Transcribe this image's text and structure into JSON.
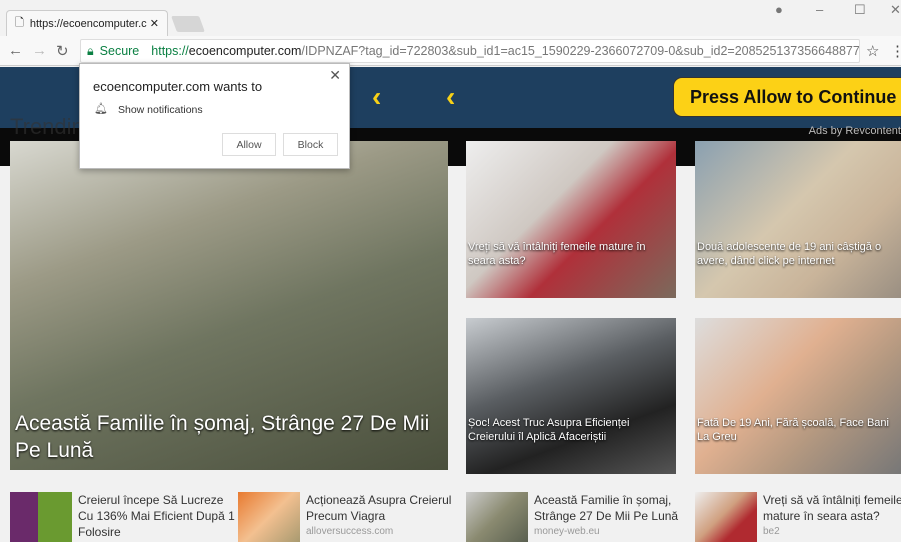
{
  "browser": {
    "tab_title": "https://ecoencomputer.c",
    "secure_label": "Secure",
    "url_scheme": "https://",
    "url_host": "ecoencomputer.com",
    "url_rest": "/IDPNZAF?tag_id=722803&sub_id1=ac15_1590229-2366072709-0&sub_id2=2085251373566488779&co..."
  },
  "banner": {
    "cta": "Press Allow to Continue",
    "trending": "Trending",
    "ads_by": "Ads by Revcontent",
    "accent": "#fcd116",
    "bg": "#1e3f5f"
  },
  "popup": {
    "title": "ecoencomputer.com wants to",
    "permission": "Show notifications",
    "allow": "Allow",
    "block": "Block"
  },
  "tiles": {
    "main": "Această Familie în șomaj, Strânge 27 De Mii Pe Lună",
    "items": [
      "Vreți să vă întâlniți femeile mature în seara asta?",
      "Două adolescente de 19 ani câștigă o avere, dând click pe internet",
      "Șoc! Acest Truc Asupra Eficienței Creierului îl Aplică Afaceriștii",
      "Fată De 19 Ani, Fără școală, Face Bani La Greu"
    ]
  },
  "bottom": [
    {
      "title": "Creierul începe Să Lucreze Cu 136% Mai Eficient După 1 Folosire",
      "source": ""
    },
    {
      "title": "Acționează Asupra Creierul Precum Viagra",
      "source": "alloversuccess.com"
    },
    {
      "title": "Această Familie în șomaj, Strânge 27 De Mii Pe Lună",
      "source": "money-web.eu"
    },
    {
      "title": "Vreți să vă întâlniți femeile mature în seara asta?",
      "source": "be2"
    }
  ]
}
